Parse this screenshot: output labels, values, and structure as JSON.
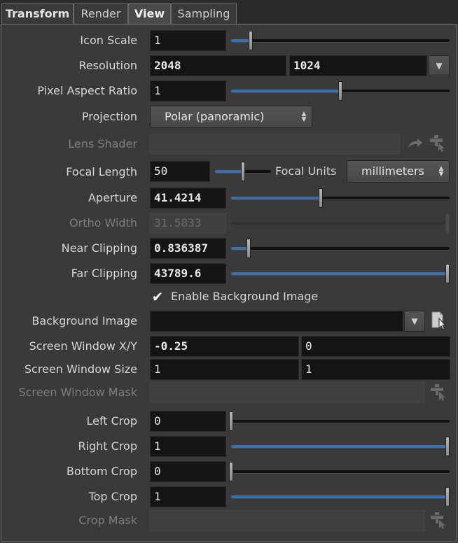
{
  "tabs": [
    {
      "label": "Transform",
      "active": false
    },
    {
      "label": "Render",
      "active": false
    },
    {
      "label": "View",
      "active": true
    },
    {
      "label": "Sampling",
      "active": false
    }
  ],
  "icon_scale": {
    "label": "Icon Scale",
    "value": "1",
    "slider_fraction": 0.09
  },
  "resolution": {
    "label": "Resolution",
    "x": "2048",
    "y": "1024"
  },
  "pixel_aspect_ratio": {
    "label": "Pixel Aspect Ratio",
    "value": "1",
    "slider_fraction": 0.5
  },
  "projection": {
    "label": "Projection",
    "value": "Polar (panoramic)"
  },
  "lens_shader": {
    "label": "Lens Shader",
    "value": ""
  },
  "focal_length": {
    "label": "Focal Length",
    "value": "50",
    "slider_fraction": 0.5
  },
  "focal_units": {
    "label": "Focal Units",
    "value": "millimeters"
  },
  "aperture": {
    "label": "Aperture",
    "value": "41.4214",
    "slider_fraction": 0.41
  },
  "ortho_width": {
    "label": "Ortho Width",
    "value": "31.5833"
  },
  "near_clipping": {
    "label": "Near Clipping",
    "value": "0.836387",
    "slider_fraction": 0.08
  },
  "far_clipping": {
    "label": "Far Clipping",
    "value": "43789.6",
    "slider_fraction": 1.0
  },
  "enable_background_image": {
    "label": "Enable Background Image",
    "checked": true
  },
  "background_image": {
    "label": "Background Image",
    "value": ""
  },
  "screen_window_xy": {
    "label": "Screen Window X/Y",
    "x": "-0.25",
    "y": "0"
  },
  "screen_window_size": {
    "label": "Screen Window Size",
    "x": "1",
    "y": "1"
  },
  "screen_window_mask": {
    "label": "Screen Window Mask",
    "value": ""
  },
  "left_crop": {
    "label": "Left Crop",
    "value": "0",
    "slider_fraction": 0.0
  },
  "right_crop": {
    "label": "Right Crop",
    "value": "1",
    "slider_fraction": 1.0
  },
  "bottom_crop": {
    "label": "Bottom Crop",
    "value": "0",
    "slider_fraction": 0.0
  },
  "top_crop": {
    "label": "Top Crop",
    "value": "1",
    "slider_fraction": 1.0
  },
  "crop_mask": {
    "label": "Crop Mask",
    "value": ""
  },
  "colors": {
    "accent": "#3b6fb0",
    "field_bg": "#141414",
    "panel_bg": "#3a3a3a"
  }
}
